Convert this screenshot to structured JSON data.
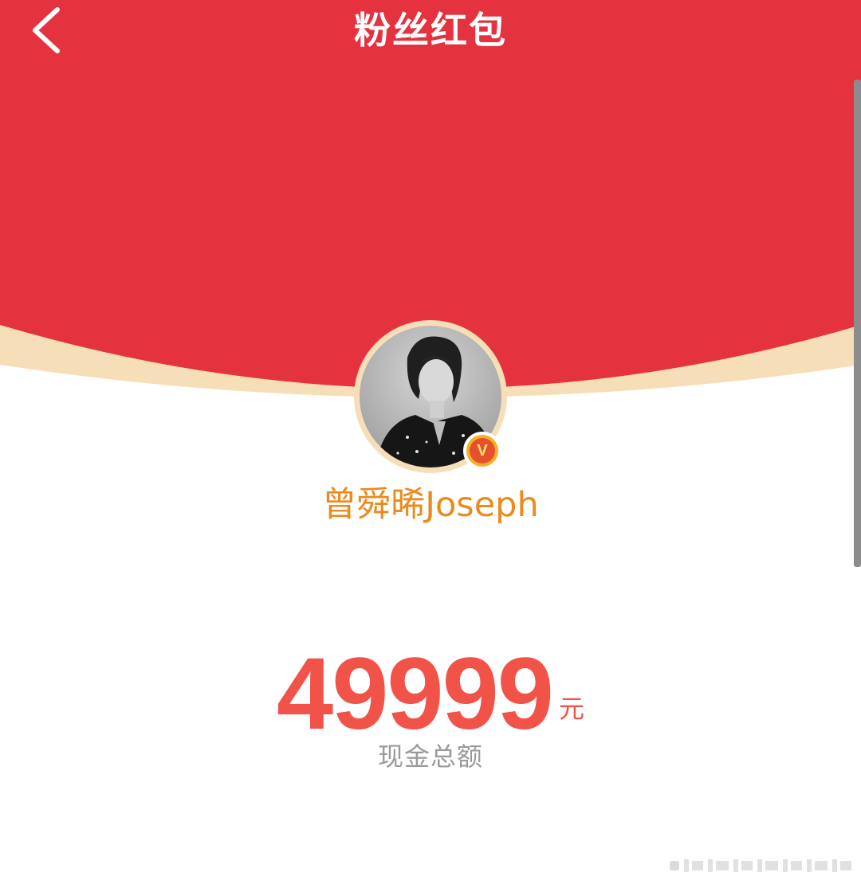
{
  "header": {
    "title": "粉丝红包",
    "back_icon": "chevron-left-icon"
  },
  "profile": {
    "name": "曾舜晞Joseph",
    "verified_icon": "verified-v-icon",
    "verified_label": "V"
  },
  "red_packet": {
    "amount": "49999",
    "unit": "元",
    "label": "现金总额"
  },
  "colors": {
    "header_red": "#e5323f",
    "amount_red": "#f25349",
    "name_orange": "#eb8a1d",
    "label_gray": "#9a9a9a",
    "cream_accent": "#f6dfb8"
  }
}
